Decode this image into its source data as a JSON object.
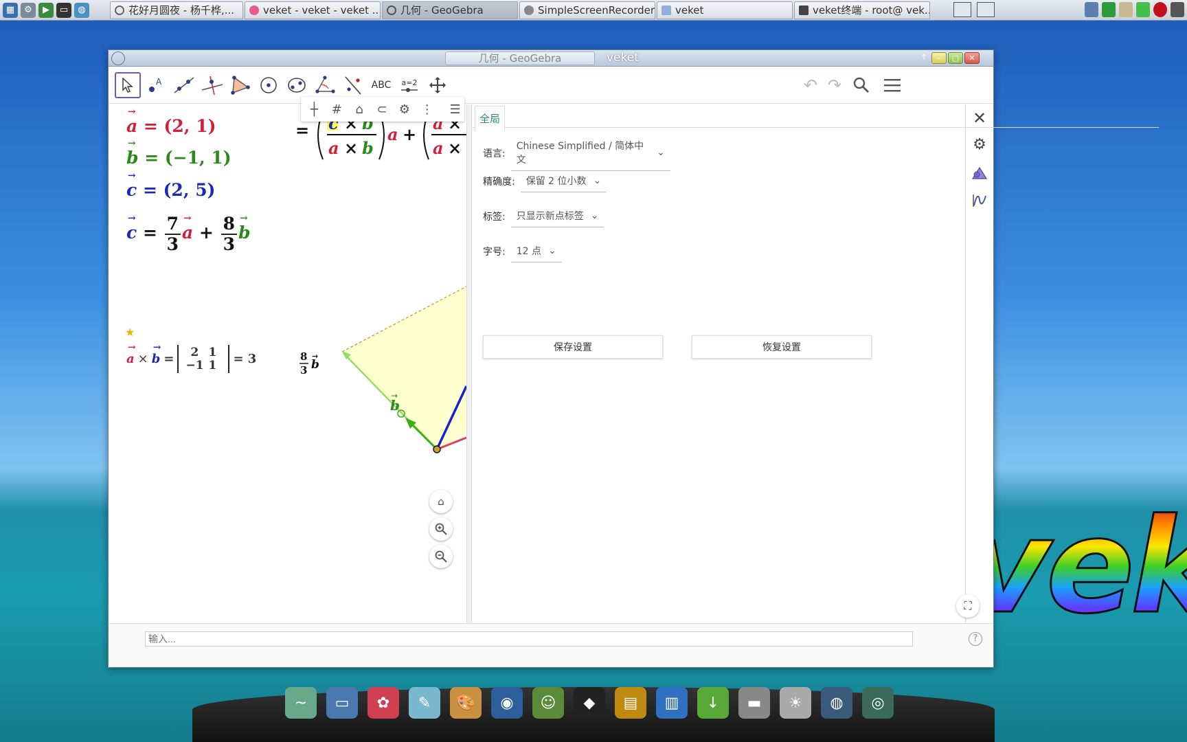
{
  "taskbar": {
    "tasks": [
      {
        "label": "花好月圆夜 - 杨千桦,...",
        "icon": "music-icon"
      },
      {
        "label": "veket - veket - veket ...",
        "icon": "browser-icon"
      },
      {
        "label": "几何 - GeoGebra",
        "icon": "geogebra-icon",
        "active": true
      },
      {
        "label": "SimpleScreenRecorder",
        "icon": "recorder-icon"
      },
      {
        "label": "veket",
        "icon": "folder-icon"
      },
      {
        "label": "veket终端 - root@ vek...",
        "icon": "terminal-icon"
      }
    ]
  },
  "desktop": {
    "brand_text": "veket"
  },
  "window": {
    "tab_title": "几何 - GeoGebra",
    "title": "veket",
    "toolbar": {
      "text_tool_label": "ABC",
      "slider_tool_label": "a=2"
    }
  },
  "algebra": {
    "a_def": " = (2, 1)",
    "b_def": " = (−1, 1)",
    "c_def": " = (2, 5)",
    "combo_coef_a_num": "7",
    "combo_coef_a_den": "3",
    "combo_coef_b_num": "8",
    "combo_coef_b_den": "3",
    "det_cells": [
      "2",
      "1",
      "−1",
      "1"
    ],
    "det_result": "= 3"
  },
  "graphics": {
    "label_coef_num": "8",
    "label_coef_den": "3"
  },
  "settings": {
    "tab_label": "全局",
    "language_label": "语言:",
    "language_value": "Chinese Simplified / 简体中文",
    "precision_label": "精确度:",
    "precision_value": "保留 2 位小数",
    "labeling_label": "标签:",
    "labeling_value": "只显示新点标签",
    "font_size_label": "字号:",
    "font_size_value": "12 点",
    "save_button": "保存设置",
    "restore_button": "恢复设置"
  },
  "input_bar": {
    "placeholder": "输入..."
  },
  "colors": {
    "vector_a": "#d21f3c",
    "vector_b": "#2a8a1a",
    "vector_c": "#1a2ab8",
    "accent": "#6557d2",
    "tab_accent": "#2d8b7e"
  }
}
